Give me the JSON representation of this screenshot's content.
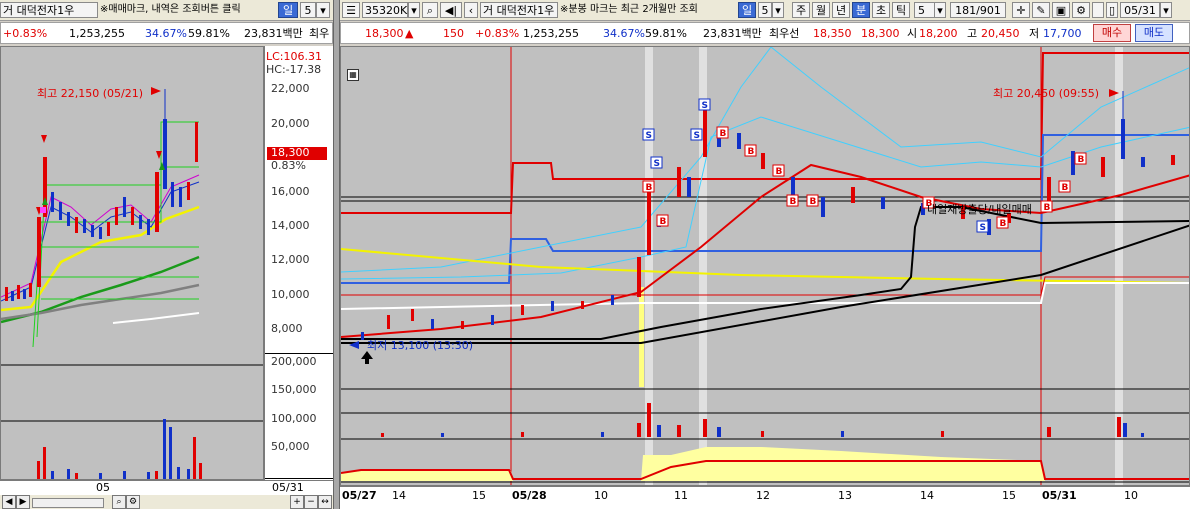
{
  "left": {
    "toolbar": {
      "code_prefix": "거",
      "name": "대덕전자1우",
      "mark_note": "※매매마크, 내역은 조회버튼 클릭",
      "period": "일",
      "period_num": "5"
    },
    "quote": {
      "change": "+0.83%",
      "volume": "1,253,255",
      "ratio": "34.67%",
      "rate": "59.81%",
      "amount": "23,831백만",
      "extra": "최우"
    },
    "legend": {
      "lc": "LC:106.31",
      "hc": "HC:-17.38"
    },
    "annotation_high": "최고 22,150 (05/21)",
    "price_ticks": [
      "22,000",
      "20,000",
      "18,000",
      "16,000",
      "14,000",
      "12,000",
      "10,000",
      "8,000"
    ],
    "current_price": "18,300",
    "current_pct": "0.83%",
    "volume_ticks": [
      "200,000",
      "150,000",
      "100,000",
      "50,000"
    ],
    "x_labels": [
      "05"
    ],
    "date_label": "05/31"
  },
  "right": {
    "toolbar": {
      "code": "35320K",
      "code_prefix": "거",
      "name": "대덕전자1우",
      "mark_note": "※분봉 마크는 최근 2개월만 조회",
      "period": "일",
      "period_num": "5",
      "tabs": [
        "주",
        "월",
        "년",
        "분",
        "초",
        "틱"
      ],
      "selected_tab": "분",
      "interval": "5",
      "page": "181/901",
      "date": "05/31"
    },
    "quote": {
      "price": "18,300",
      "arrow": "▲",
      "diff": "150",
      "change": "+0.83%",
      "volume": "1,253,255",
      "ratio": "34.67%",
      "rate": "59.81%",
      "amount": "23,831백만",
      "pref_label": "최우선",
      "ask": "18,350",
      "bid": "18,300",
      "open_label": "시",
      "open": "18,200",
      "high_label": "고",
      "high": "20,450",
      "low_label": "저",
      "low": "17,700",
      "buy_label": "매수",
      "sell_label": "매도"
    },
    "annotation_high": "최고 20,450 (09:55)",
    "annotation_low": "최저 13,100 (13:30)",
    "overlay_text": "내일재방출당/내일매매",
    "x_labels": [
      "05/27",
      "14",
      "15",
      "05/28",
      "10",
      "11",
      "12",
      "13",
      "14",
      "15",
      "05/31",
      "10"
    ]
  },
  "colors": {
    "accent": "#3a6ad4",
    "up": "#e00000",
    "down": "#1030c8",
    "chart_bg": "#c0c0c0"
  }
}
